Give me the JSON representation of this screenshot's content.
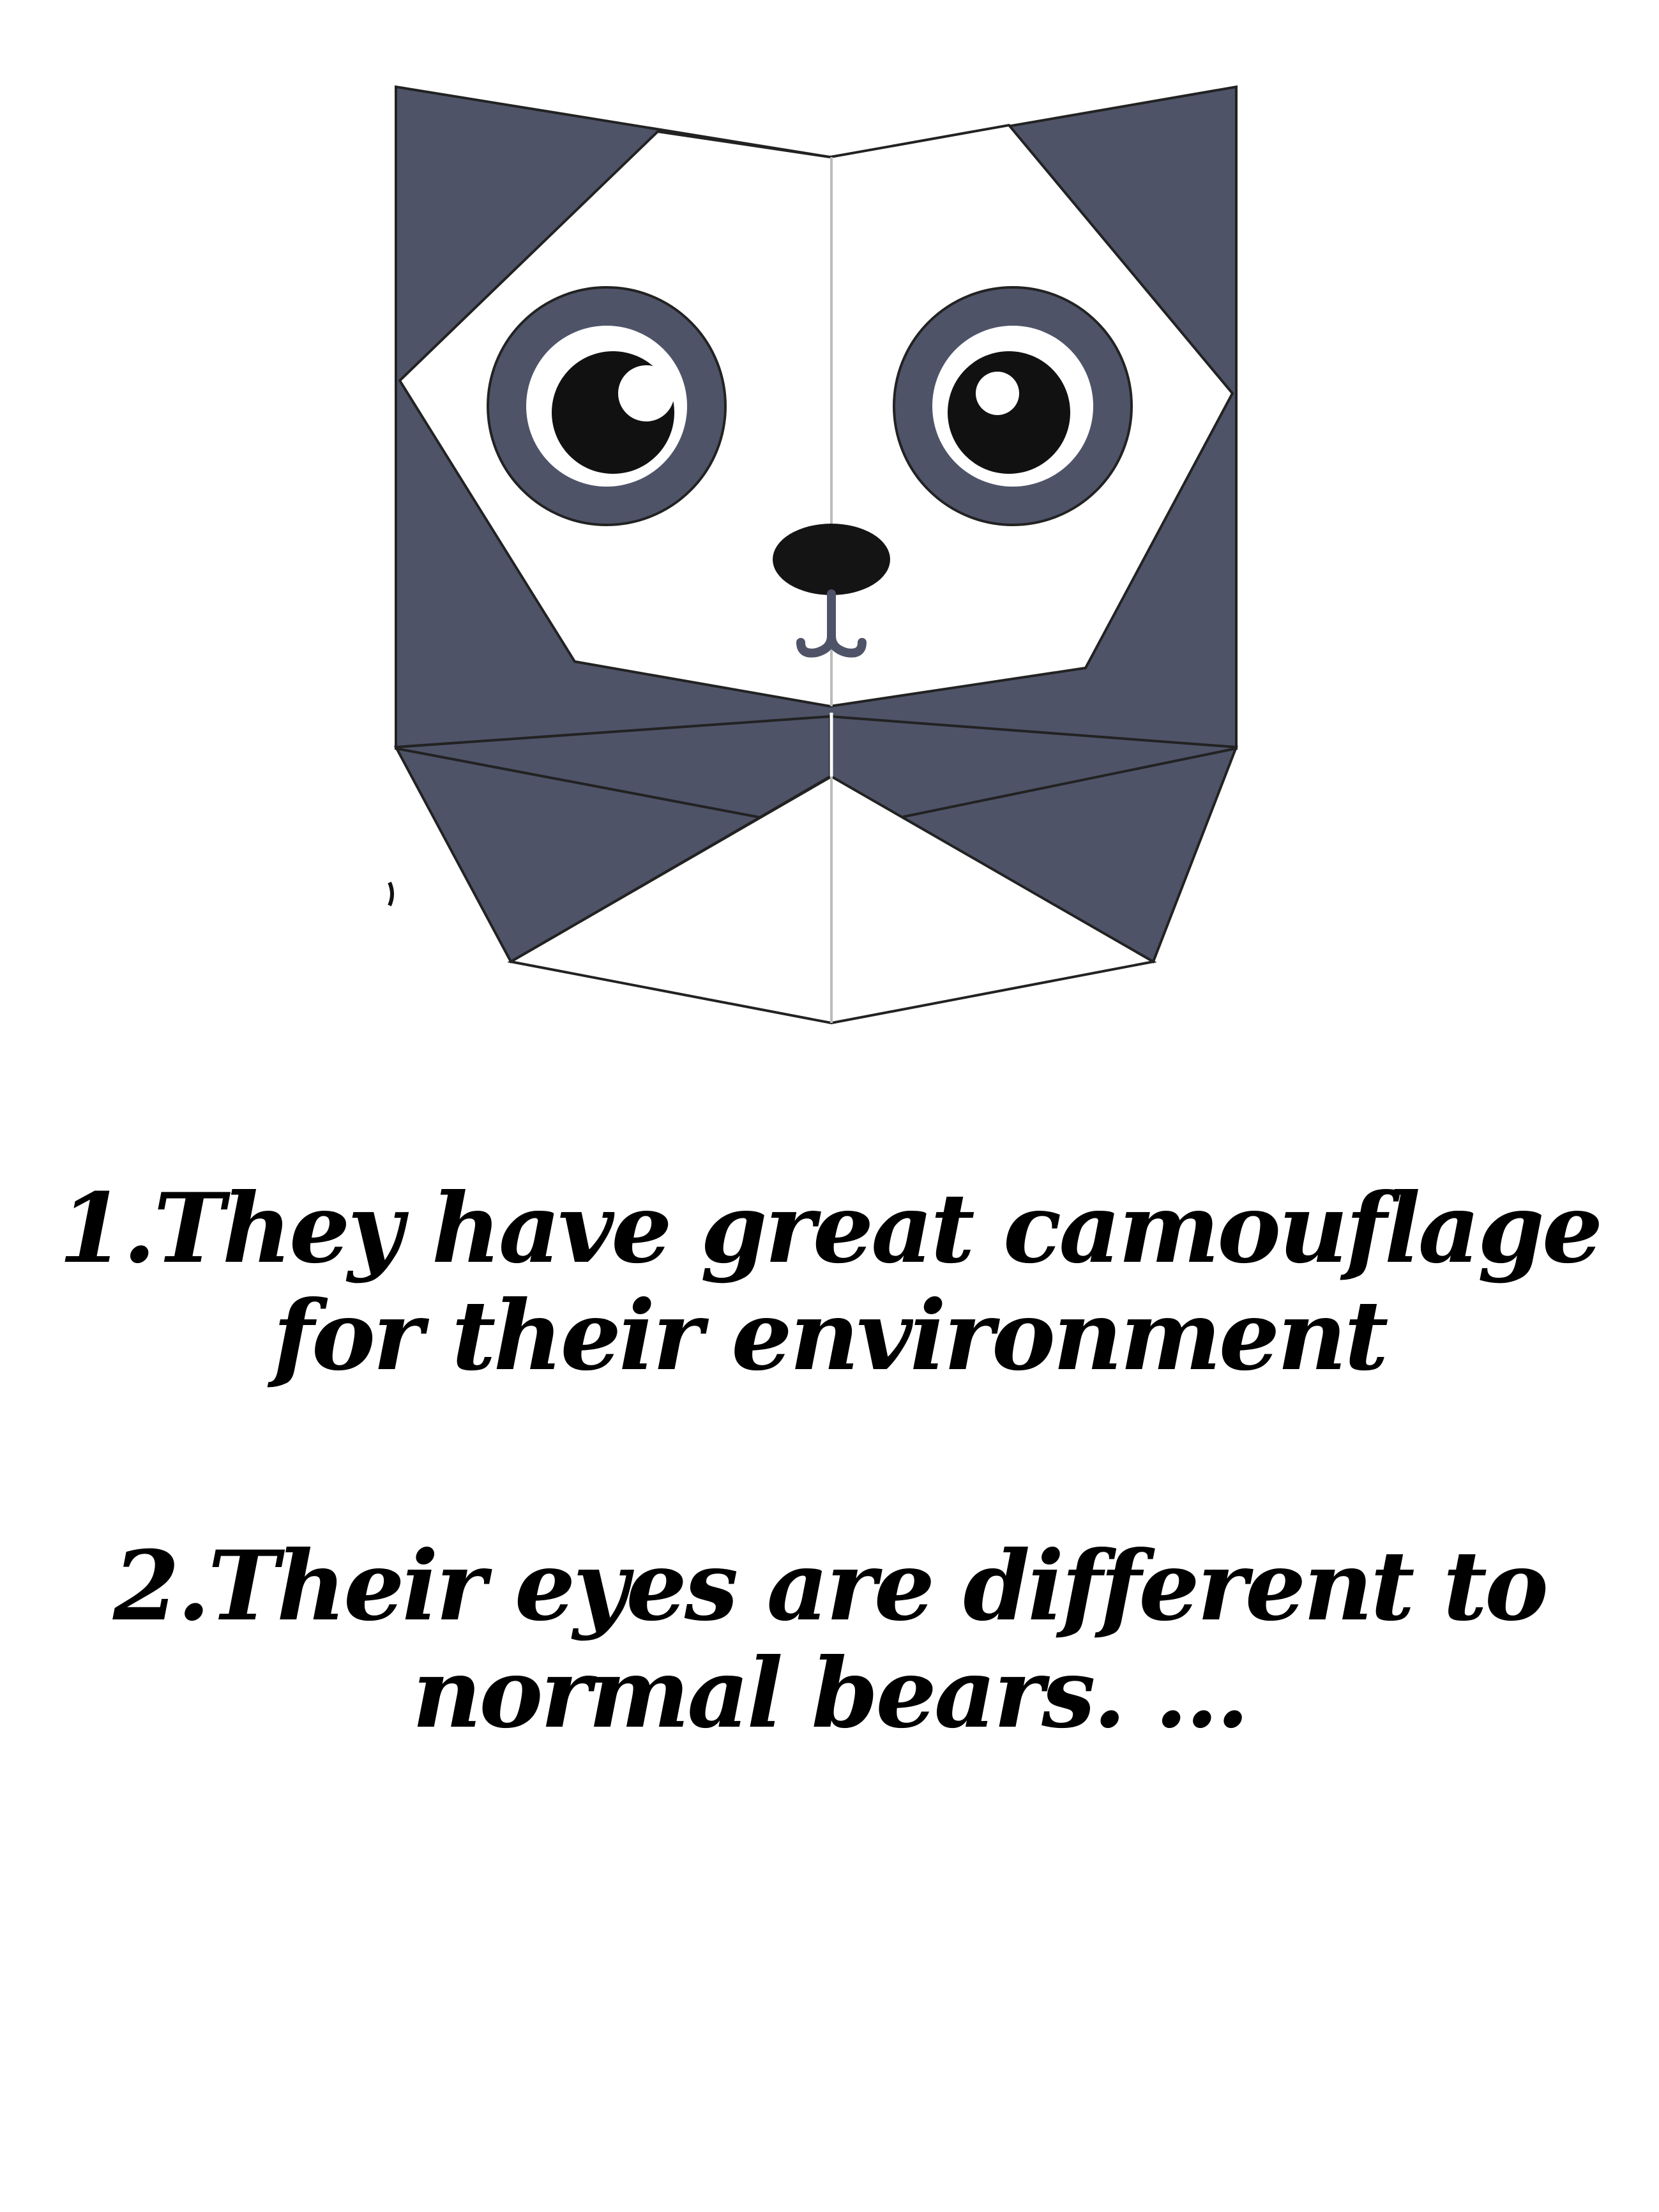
{
  "illustration": {
    "subject": "origami-panda-face",
    "colors": {
      "dark": "#4e5368",
      "light": "#ffffff",
      "outline": "#222222",
      "pupil": "#111111",
      "nose": "#141414"
    }
  },
  "facts": [
    {
      "text": "1.They have great camouflage for their environment"
    },
    {
      "text": "2.Their eyes are different to normal bears. ..."
    }
  ]
}
